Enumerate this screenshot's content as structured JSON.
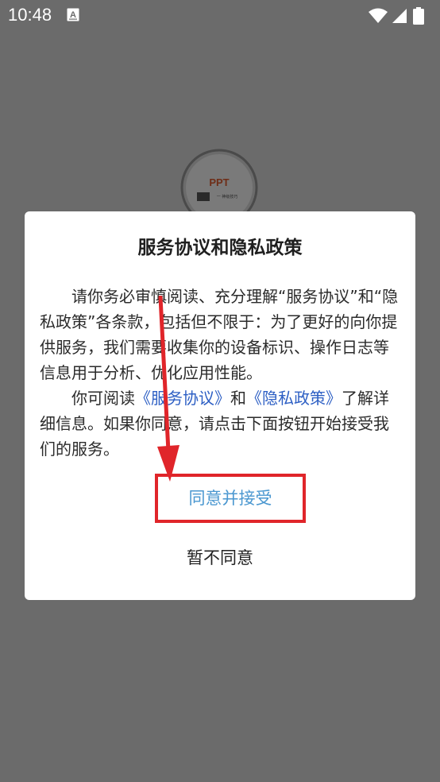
{
  "status_bar": {
    "time": "10:48",
    "notification_icon": "a-text-icon",
    "wifi_icon": "wifi-icon",
    "signal_icon": "cellular-signal-icon",
    "battery_icon": "battery-icon"
  },
  "background_logo": {
    "text": "PPT",
    "subtext": "一 神级技巧"
  },
  "dialog": {
    "title": "服务协议和隐私政策",
    "paragraph1": "请你务必审慎阅读、充分理解“服务协议”和“隐私政策”各条款，包括但不限于：为了更好的向你提供服务，我们需要收集你的设备标识、操作日志等信息用于分析、优化应用性能。",
    "p2_prefix": "你可阅读",
    "service_link": "《服务协议》",
    "p2_and": "和",
    "privacy_link": "《隐私政策》",
    "p2_suffix": "了解详细信息。如果你同意，请点击下面按钮开始接受我们的服务。",
    "agree_label": "同意并接受",
    "reject_label": "暂不同意"
  },
  "colors": {
    "overlay": "#6b6b6b",
    "link": "#2d5fc4",
    "agree_text": "#4a97d0",
    "highlight_box": "#e0252a",
    "arrow": "#e0252a"
  }
}
